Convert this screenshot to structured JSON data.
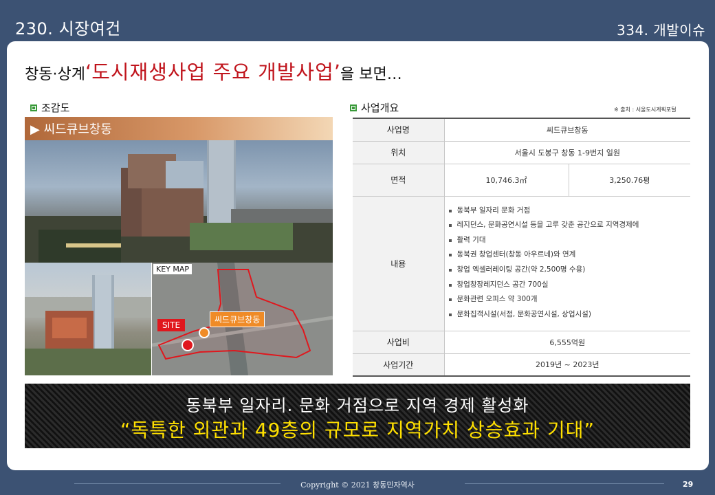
{
  "header": {
    "left_title": "230. 시장여건",
    "right_title": "334. 개발이슈"
  },
  "headline": {
    "prefix": "창동·상계",
    "open_quote": "‘",
    "highlight": "도시재생사업 주요 개발사업",
    "close_quote": "’",
    "suffix": "을 보면…"
  },
  "left_section": {
    "label": "조감도",
    "banner": "▶ 씨드큐브창동",
    "keymap_label": "KEY MAP",
    "site_label": "SITE",
    "seed_label": "씨드큐브창동"
  },
  "right_section": {
    "label": "사업개요",
    "source": "※ 출처 : 서울도시계획포털",
    "rows": [
      {
        "label": "사업명",
        "value": "씨드큐브창동"
      },
      {
        "label": "위치",
        "value": "서울시 도봉구 창동 1-9번지 일원"
      },
      {
        "label": "면적",
        "value_a": "10,746.3㎡",
        "value_b": "3,250.76평"
      },
      {
        "label": "내용",
        "items": [
          "동북부 일자리 문화 거점",
          "레지던스, 문화공연시설 등을 고루 갖춘 공간으로 지역경제에",
          "활력 기대",
          "동북권 창업센터(창동 아우르네)와 연계",
          "창업 엑셀러레이팅 공간(약 2,500명  수용)",
          "창업창장레지던스 공간 700실",
          "문화관련 오피스 약 300개",
          "문화집객시설(서점, 문화공연시설, 상업시설)"
        ]
      },
      {
        "label": "사업비",
        "value": "6,555억원"
      },
      {
        "label": "사업기간",
        "value": "2019년  ~ 2023년"
      }
    ]
  },
  "summary": {
    "line1": "동북부 일자리. 문화 거점으로 지역 경제 활성화",
    "line2": "“독특한 외관과 49층의 규모로 지역가치 상승효과 기대”"
  },
  "footer": {
    "copyright": "Copyright  ©  2021  창동민자역사",
    "page": "29"
  },
  "colors": {
    "background": "#3c5273",
    "accent_red": "#c0141c",
    "highlight_yellow": "#ffe000",
    "site_red": "#e0171d",
    "seed_orange": "#ef8b27"
  }
}
